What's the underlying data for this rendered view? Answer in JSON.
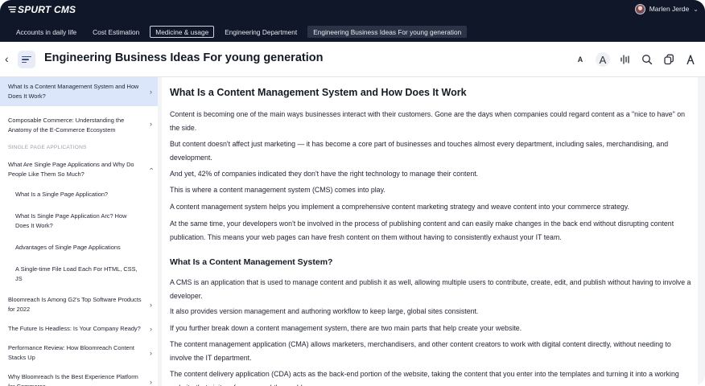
{
  "app": {
    "logo_text": "SPURT CMS"
  },
  "user": {
    "name": "Marlen Jerde"
  },
  "nav_tabs": [
    {
      "label": "Accounts in daily life"
    },
    {
      "label": "Cost Estimation"
    },
    {
      "label": "Medicine & usage"
    },
    {
      "label": "Engineering Department"
    },
    {
      "label": "Engineering Business Ideas For young generation"
    }
  ],
  "header": {
    "title": "Engineering Business Ideas For young generation"
  },
  "toolbar": {
    "font_small_label": "A",
    "font_large_label": "A"
  },
  "sidebar": {
    "items": [
      {
        "label": "What Is a Content Management System and How Does It Work?"
      },
      {
        "label": "Composable Commerce: Understanding the Anatomy of the E-Commerce Ecosystem"
      },
      {
        "label": "SINGLE PAGE APPLICATIONS"
      },
      {
        "label": "What Are Single Page Applications and Why Do People Like Them So Much?"
      },
      {
        "label": "What Is a Single Page Application?"
      },
      {
        "label": "What Is Single Page Application Arc? How Does It Work?"
      },
      {
        "label": "Advantages of Single Page Applications"
      },
      {
        "label": "A Single-time File Load Each For HTML, CSS, JS"
      },
      {
        "label": "Bloomreach Is Among G2's Top Software Products for 2022"
      },
      {
        "label": "The Future Is Headless: Is Your Company Ready?"
      },
      {
        "label": "Performance Review: How Bloomreach Content Stacks Up"
      },
      {
        "label": "Why Bloomreach Is the Best Experience Platform for Commerce"
      }
    ]
  },
  "article": {
    "title": "What Is a Content Management System and How Does It Work",
    "paragraphs": [
      "Content is becoming one of the main ways businesses interact with their customers. Gone are the days when companies could regard content as a \"nice to have\" on the side.",
      "But content doesn't affect just marketing — it has become a core part of businesses and touches almost every department, including sales, merchandising, and development.",
      "And yet, 42% of companies indicated they don't have the right technology to manage their content.",
      "This is where a content management system (CMS) comes into play.",
      "A content management system helps you implement a comprehensive content marketing strategy and weave content into your commerce strategy.",
      "At the same time, your developers won't be involved in the process of publishing content and can easily make changes in the back end without disrupting content publication. This means your web pages can have fresh content on them without having to consistently exhaust your IT team."
    ],
    "subtitle": "What Is a Content Management System?",
    "paragraphs2": [
      "A CMS is an application that is used to manage content and publish it as well, allowing multiple users to contribute, create, edit, and publish without having to involve a developer.",
      "It also provides version management and authoring workflow to keep large, global sites consistent.",
      "If you further break down a content management system, there are two main parts that help create your website.",
      "The content management application (CMA) allows marketers, merchandisers, and other content creators to work with digital content directly, without needing to involve the IT department.",
      "The content delivery application (CDA) acts as the back-end portion of the website, taking the content that you enter into the templates and turning it into a working website that visitors from around the world can access."
    ]
  }
}
